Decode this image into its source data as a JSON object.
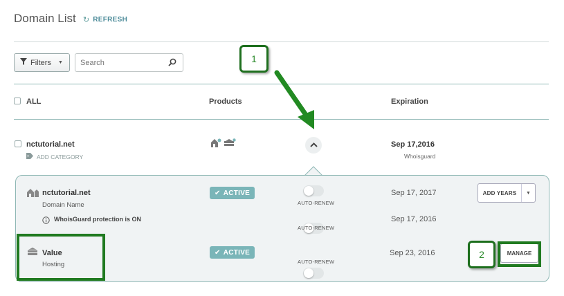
{
  "header": {
    "title": "Domain List",
    "refresh_label": "REFRESH"
  },
  "toolbar": {
    "filters_label": "Filters",
    "search_placeholder": "Search"
  },
  "table": {
    "columns": {
      "all": "ALL",
      "products": "Products",
      "expiration": "Expiration"
    },
    "row": {
      "domain": "nctutorial.net",
      "add_category": "ADD CATEGORY",
      "expiration_date": "Sep 17,2016",
      "expiration_sub": "Whoisguard"
    }
  },
  "details": {
    "domain": {
      "name": "nctutorial.net",
      "type": "Domain Name",
      "status": "ACTIVE",
      "auto_renew_label": "AUTO-RENEW",
      "auto_renew_on": false,
      "date": "Sep 17, 2017",
      "add_years_label": "ADD YEARS"
    },
    "whoisguard": {
      "label": "WhoisGuard protection is ON",
      "auto_renew_label": "AUTO-RENEW",
      "auto_renew_on": false,
      "date": "Sep 17, 2016"
    },
    "hosting": {
      "name": "Value",
      "type": "Hosting",
      "status": "ACTIVE",
      "auto_renew_label": "AUTO-RENEW",
      "auto_renew_on": false,
      "date": "Sep 23, 2016",
      "manage_label": "MANAGE"
    }
  },
  "annotations": {
    "callout_1": "1",
    "callout_2": "2"
  },
  "colors": {
    "accent": "#4a8a98",
    "badge": "#7ab5b8",
    "highlight": "#207a20",
    "panel_bg": "#f0f3f4"
  },
  "icons": [
    "refresh-icon",
    "filter-icon",
    "search-icon",
    "tag-icon",
    "domain-icon",
    "hosting-icon",
    "chevron-up-icon",
    "checkmark-icon",
    "info-icon",
    "caret-down-icon"
  ]
}
